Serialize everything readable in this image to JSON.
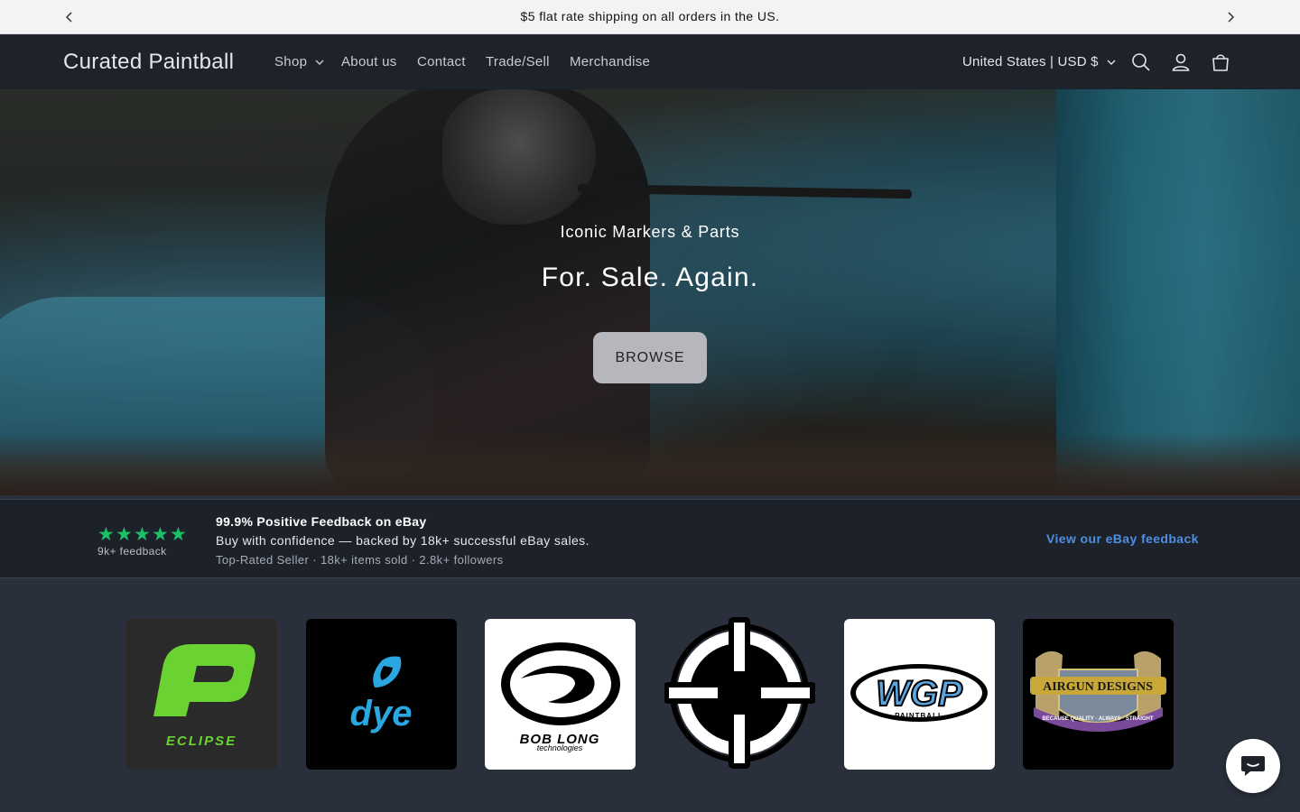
{
  "announcement": {
    "message": "$5 flat rate shipping on all orders in the US."
  },
  "header": {
    "brand": "Curated Paintball",
    "nav": {
      "shop": "Shop",
      "about": "About us",
      "contact": "Contact",
      "trade": "Trade/Sell",
      "merch": "Merchandise"
    },
    "locale": "United States | USD $"
  },
  "hero": {
    "subtitle": "Iconic Markers & Parts",
    "title": "For. Sale. Again.",
    "button": "BROWSE"
  },
  "feedback": {
    "stars": "★★★★★",
    "rating_stars": 5,
    "count": "9k+ feedback",
    "headline": "99.9% Positive Feedback on eBay",
    "line": "Buy with confidence — backed by 18k+ successful eBay sales.",
    "stats": "Top-Rated Seller · 18k+ items sold · 2.8k+ followers",
    "link": "View our eBay feedback"
  },
  "brands": {
    "eclipse": "ECLIPSE",
    "dye": "dye",
    "boblong": "BOB LONG",
    "boblong_sub": "technologies",
    "wgp": "WGP",
    "wgp_sub": "PAINTBALL",
    "airgun": "AIRGUN DESIGNS",
    "airgun_sub": "BECAUSE QUALITY · ALWAYS · STRAIGHT"
  },
  "colors": {
    "header_bg": "#1e222b",
    "page_bg": "#2a303b",
    "star_green": "#1fbf6a",
    "link_blue": "#4f8fe0",
    "eclipse_green": "#6ad231",
    "dye_blue": "#2aa6e0"
  }
}
